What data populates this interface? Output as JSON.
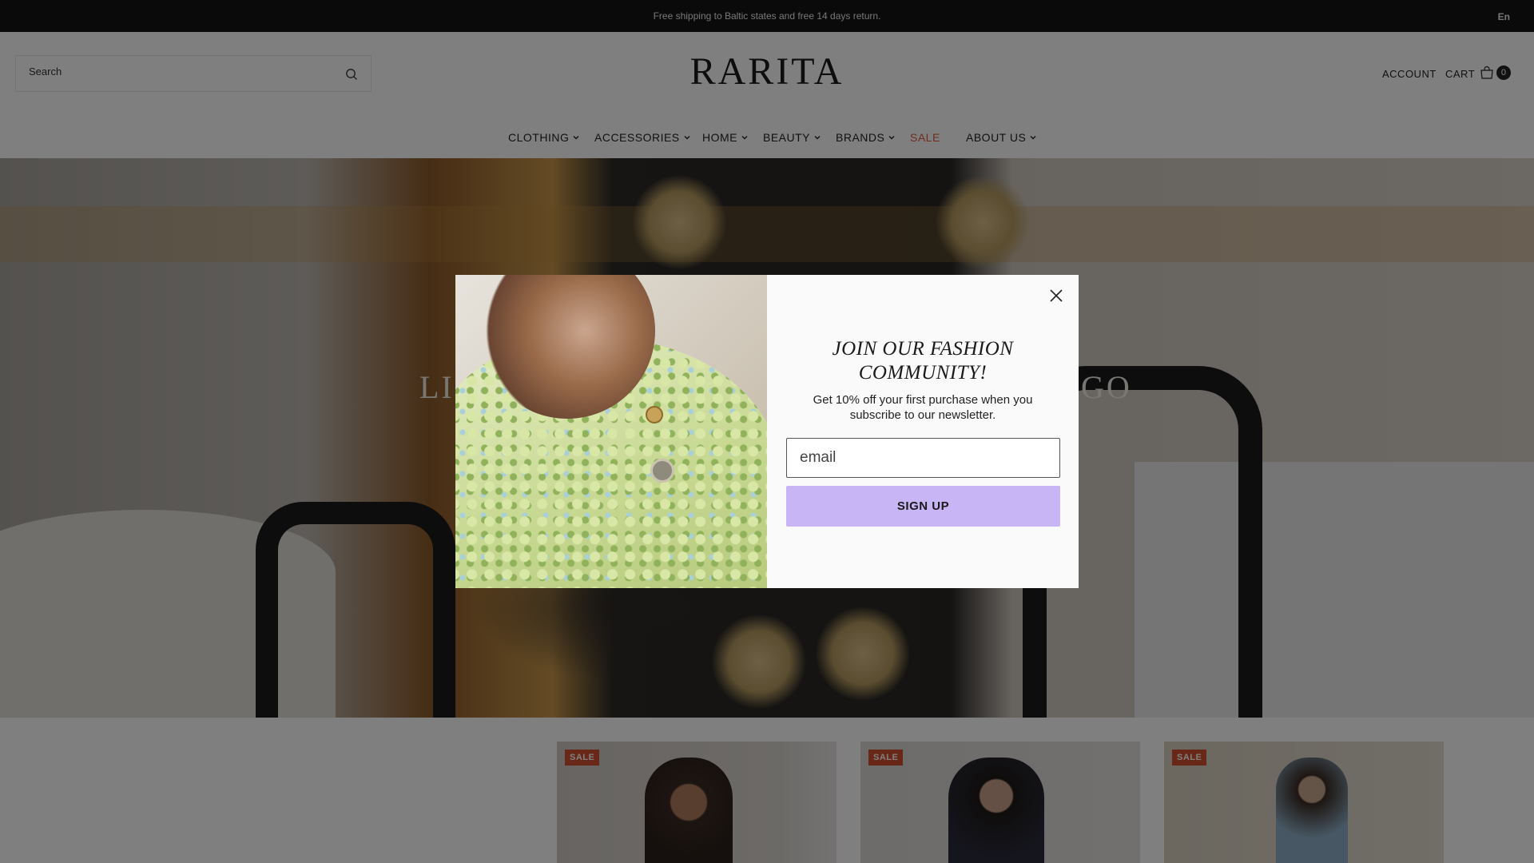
{
  "announcement": {
    "message": "Free shipping to Baltic states and free 14 days return.",
    "language": "En"
  },
  "header": {
    "search_placeholder": "Search",
    "logo": "RARITA",
    "account_label": "ACCOUNT",
    "cart_label": "CART",
    "cart_count": "0"
  },
  "nav": {
    "items": [
      {
        "label": "CLOTHING",
        "has_dropdown": true
      },
      {
        "label": "ACCESSORIES",
        "has_dropdown": true
      },
      {
        "label": "HOME",
        "has_dropdown": true
      },
      {
        "label": "BEAUTY",
        "has_dropdown": true
      },
      {
        "label": "BRANDS",
        "has_dropdown": true
      },
      {
        "label": "SALE",
        "has_dropdown": false
      },
      {
        "label": "ABOUT US",
        "has_dropdown": true
      }
    ]
  },
  "hero": {
    "headline_left": "LIC",
    "headline_right": "GO"
  },
  "products": {
    "badges": [
      "SALE",
      "SALE",
      "SALE"
    ]
  },
  "modal": {
    "title": "JOIN OUR FASHION COMMUNITY!",
    "subtitle": "Get 10% off your first purchase when you subscribe to our newsletter.",
    "email_placeholder": "email",
    "signup_label": "SIGN UP"
  },
  "colors": {
    "sale": "#e05a3c",
    "badge": "#d2512f",
    "signup_button": "#c8b5f5",
    "announcement_bg": "#141414"
  },
  "icons": {
    "search": "search-icon",
    "cart": "shopping-bag-icon",
    "close": "close-icon",
    "dropdown": "chevron-down-icon"
  }
}
